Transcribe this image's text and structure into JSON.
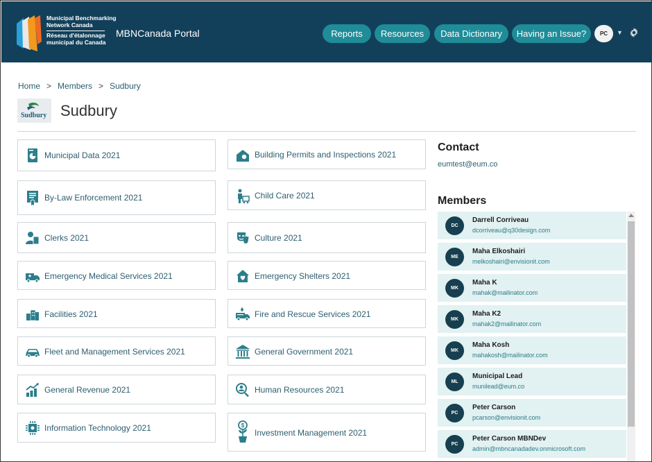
{
  "header": {
    "logo_line1": "Municipal Benchmarking",
    "logo_line2": "Network Canada",
    "logo_line3": "Réseau d'étalonnage",
    "logo_line4": "municipal du Canada",
    "portal_title": "MBNCanada Portal",
    "nav": [
      "Reports",
      "Resources",
      "Data Dictionary",
      "Having an Issue?"
    ],
    "user_initials": "PC"
  },
  "breadcrumb": [
    "Home",
    "Members",
    "Sudbury"
  ],
  "breadcrumb_sep": ">",
  "page_title": "Sudbury",
  "municipality_logo_text": "Sudbury",
  "reports": [
    {
      "label": "Municipal Data 2021",
      "icon": "data-icon"
    },
    {
      "label": "Building Permits and Inspections 2021",
      "icon": "building-inspection-icon"
    },
    {
      "label": "By-Law Enforcement 2021",
      "icon": "certificate-icon"
    },
    {
      "label": "Child Care 2021",
      "icon": "child-care-icon"
    },
    {
      "label": "Clerks 2021",
      "icon": "clerk-icon"
    },
    {
      "label": "Culture 2021",
      "icon": "theater-masks-icon"
    },
    {
      "label": "Emergency Medical Services 2021",
      "icon": "ambulance-icon"
    },
    {
      "label": "Emergency Shelters 2021",
      "icon": "shelter-icon"
    },
    {
      "label": "Facilities 2021",
      "icon": "buildings-icon"
    },
    {
      "label": "Fire and Rescue Services 2021",
      "icon": "fire-truck-icon"
    },
    {
      "label": "Fleet and Management Services 2021",
      "icon": "car-icon"
    },
    {
      "label": "General Government 2021",
      "icon": "government-building-icon"
    },
    {
      "label": "General Revenue 2021",
      "icon": "revenue-chart-icon"
    },
    {
      "label": "Human Resources 2021",
      "icon": "user-search-icon"
    },
    {
      "label": "Information Technology 2021",
      "icon": "chip-icon"
    },
    {
      "label": "Investment Management 2021",
      "icon": "money-plant-icon"
    }
  ],
  "contact": {
    "heading": "Contact",
    "email": "eumtest@eum.co"
  },
  "members": {
    "heading": "Members",
    "items": [
      {
        "initials": "DC",
        "name": "Darrell Corriveau",
        "email": "dcorriveau@q30design.com"
      },
      {
        "initials": "ME",
        "name": "Maha Elkoshairi",
        "email": "melkoshairi@envisionit.com"
      },
      {
        "initials": "MK",
        "name": "Maha K",
        "email": "mahak@mailinator.com"
      },
      {
        "initials": "MK",
        "name": "Maha K2",
        "email": "mahak2@mailinator.com"
      },
      {
        "initials": "MK",
        "name": "Maha Kosh",
        "email": "mahakosh@mailinator.com"
      },
      {
        "initials": "ML",
        "name": "Municipal Lead",
        "email": "munilead@eum.co"
      },
      {
        "initials": "PC",
        "name": "Peter Carson",
        "email": "pcarson@envisionit.com"
      },
      {
        "initials": "PC",
        "name": "Peter Carson MBNDev",
        "email": "admin@mbncanadadev.onmicrosoft.com"
      }
    ]
  },
  "colors": {
    "header_bg": "#12405a",
    "nav_button": "#1f8c98",
    "link_text": "#2c5e6f",
    "icon": "#2b7e8b",
    "member_bg": "#e2f1f1",
    "avatar_bg": "#173f50"
  }
}
